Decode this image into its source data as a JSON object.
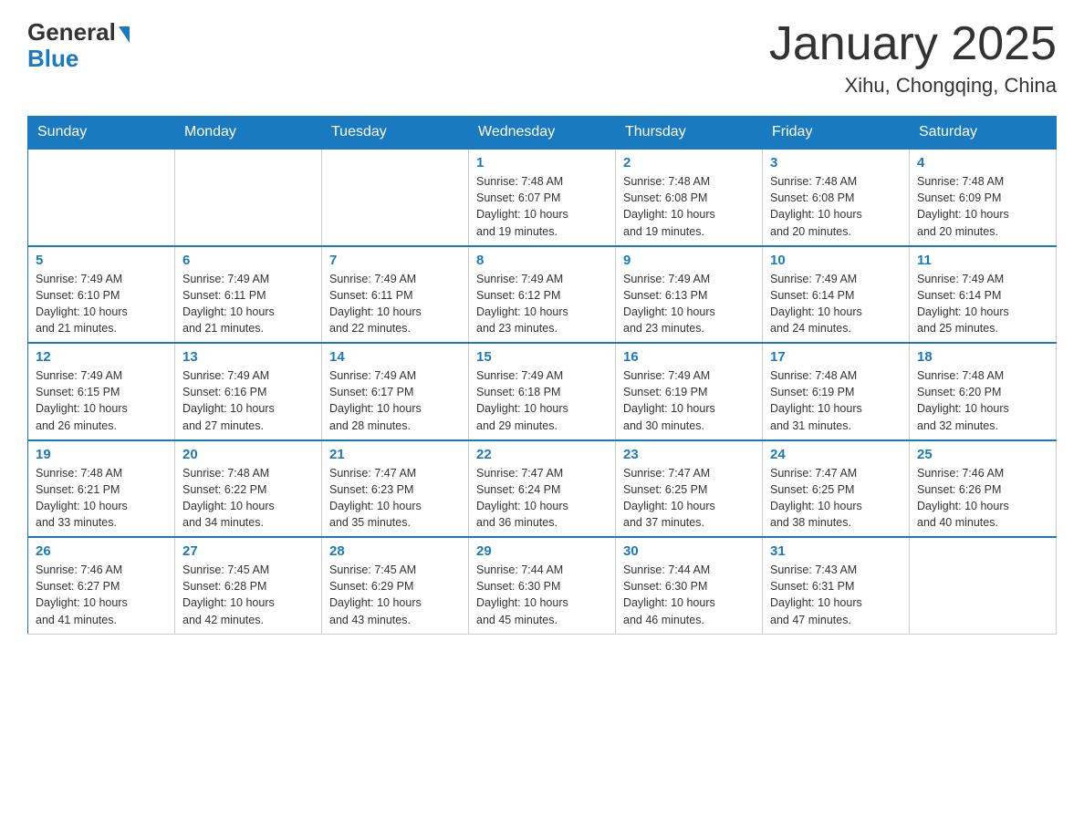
{
  "logo": {
    "general": "General",
    "blue": "Blue"
  },
  "header": {
    "month": "January 2025",
    "location": "Xihu, Chongqing, China"
  },
  "weekdays": [
    "Sunday",
    "Monday",
    "Tuesday",
    "Wednesday",
    "Thursday",
    "Friday",
    "Saturday"
  ],
  "weeks": [
    [
      {
        "day": "",
        "info": ""
      },
      {
        "day": "",
        "info": ""
      },
      {
        "day": "",
        "info": ""
      },
      {
        "day": "1",
        "info": "Sunrise: 7:48 AM\nSunset: 6:07 PM\nDaylight: 10 hours\nand 19 minutes."
      },
      {
        "day": "2",
        "info": "Sunrise: 7:48 AM\nSunset: 6:08 PM\nDaylight: 10 hours\nand 19 minutes."
      },
      {
        "day": "3",
        "info": "Sunrise: 7:48 AM\nSunset: 6:08 PM\nDaylight: 10 hours\nand 20 minutes."
      },
      {
        "day": "4",
        "info": "Sunrise: 7:48 AM\nSunset: 6:09 PM\nDaylight: 10 hours\nand 20 minutes."
      }
    ],
    [
      {
        "day": "5",
        "info": "Sunrise: 7:49 AM\nSunset: 6:10 PM\nDaylight: 10 hours\nand 21 minutes."
      },
      {
        "day": "6",
        "info": "Sunrise: 7:49 AM\nSunset: 6:11 PM\nDaylight: 10 hours\nand 21 minutes."
      },
      {
        "day": "7",
        "info": "Sunrise: 7:49 AM\nSunset: 6:11 PM\nDaylight: 10 hours\nand 22 minutes."
      },
      {
        "day": "8",
        "info": "Sunrise: 7:49 AM\nSunset: 6:12 PM\nDaylight: 10 hours\nand 23 minutes."
      },
      {
        "day": "9",
        "info": "Sunrise: 7:49 AM\nSunset: 6:13 PM\nDaylight: 10 hours\nand 23 minutes."
      },
      {
        "day": "10",
        "info": "Sunrise: 7:49 AM\nSunset: 6:14 PM\nDaylight: 10 hours\nand 24 minutes."
      },
      {
        "day": "11",
        "info": "Sunrise: 7:49 AM\nSunset: 6:14 PM\nDaylight: 10 hours\nand 25 minutes."
      }
    ],
    [
      {
        "day": "12",
        "info": "Sunrise: 7:49 AM\nSunset: 6:15 PM\nDaylight: 10 hours\nand 26 minutes."
      },
      {
        "day": "13",
        "info": "Sunrise: 7:49 AM\nSunset: 6:16 PM\nDaylight: 10 hours\nand 27 minutes."
      },
      {
        "day": "14",
        "info": "Sunrise: 7:49 AM\nSunset: 6:17 PM\nDaylight: 10 hours\nand 28 minutes."
      },
      {
        "day": "15",
        "info": "Sunrise: 7:49 AM\nSunset: 6:18 PM\nDaylight: 10 hours\nand 29 minutes."
      },
      {
        "day": "16",
        "info": "Sunrise: 7:49 AM\nSunset: 6:19 PM\nDaylight: 10 hours\nand 30 minutes."
      },
      {
        "day": "17",
        "info": "Sunrise: 7:48 AM\nSunset: 6:19 PM\nDaylight: 10 hours\nand 31 minutes."
      },
      {
        "day": "18",
        "info": "Sunrise: 7:48 AM\nSunset: 6:20 PM\nDaylight: 10 hours\nand 32 minutes."
      }
    ],
    [
      {
        "day": "19",
        "info": "Sunrise: 7:48 AM\nSunset: 6:21 PM\nDaylight: 10 hours\nand 33 minutes."
      },
      {
        "day": "20",
        "info": "Sunrise: 7:48 AM\nSunset: 6:22 PM\nDaylight: 10 hours\nand 34 minutes."
      },
      {
        "day": "21",
        "info": "Sunrise: 7:47 AM\nSunset: 6:23 PM\nDaylight: 10 hours\nand 35 minutes."
      },
      {
        "day": "22",
        "info": "Sunrise: 7:47 AM\nSunset: 6:24 PM\nDaylight: 10 hours\nand 36 minutes."
      },
      {
        "day": "23",
        "info": "Sunrise: 7:47 AM\nSunset: 6:25 PM\nDaylight: 10 hours\nand 37 minutes."
      },
      {
        "day": "24",
        "info": "Sunrise: 7:47 AM\nSunset: 6:25 PM\nDaylight: 10 hours\nand 38 minutes."
      },
      {
        "day": "25",
        "info": "Sunrise: 7:46 AM\nSunset: 6:26 PM\nDaylight: 10 hours\nand 40 minutes."
      }
    ],
    [
      {
        "day": "26",
        "info": "Sunrise: 7:46 AM\nSunset: 6:27 PM\nDaylight: 10 hours\nand 41 minutes."
      },
      {
        "day": "27",
        "info": "Sunrise: 7:45 AM\nSunset: 6:28 PM\nDaylight: 10 hours\nand 42 minutes."
      },
      {
        "day": "28",
        "info": "Sunrise: 7:45 AM\nSunset: 6:29 PM\nDaylight: 10 hours\nand 43 minutes."
      },
      {
        "day": "29",
        "info": "Sunrise: 7:44 AM\nSunset: 6:30 PM\nDaylight: 10 hours\nand 45 minutes."
      },
      {
        "day": "30",
        "info": "Sunrise: 7:44 AM\nSunset: 6:30 PM\nDaylight: 10 hours\nand 46 minutes."
      },
      {
        "day": "31",
        "info": "Sunrise: 7:43 AM\nSunset: 6:31 PM\nDaylight: 10 hours\nand 47 minutes."
      },
      {
        "day": "",
        "info": ""
      }
    ]
  ]
}
